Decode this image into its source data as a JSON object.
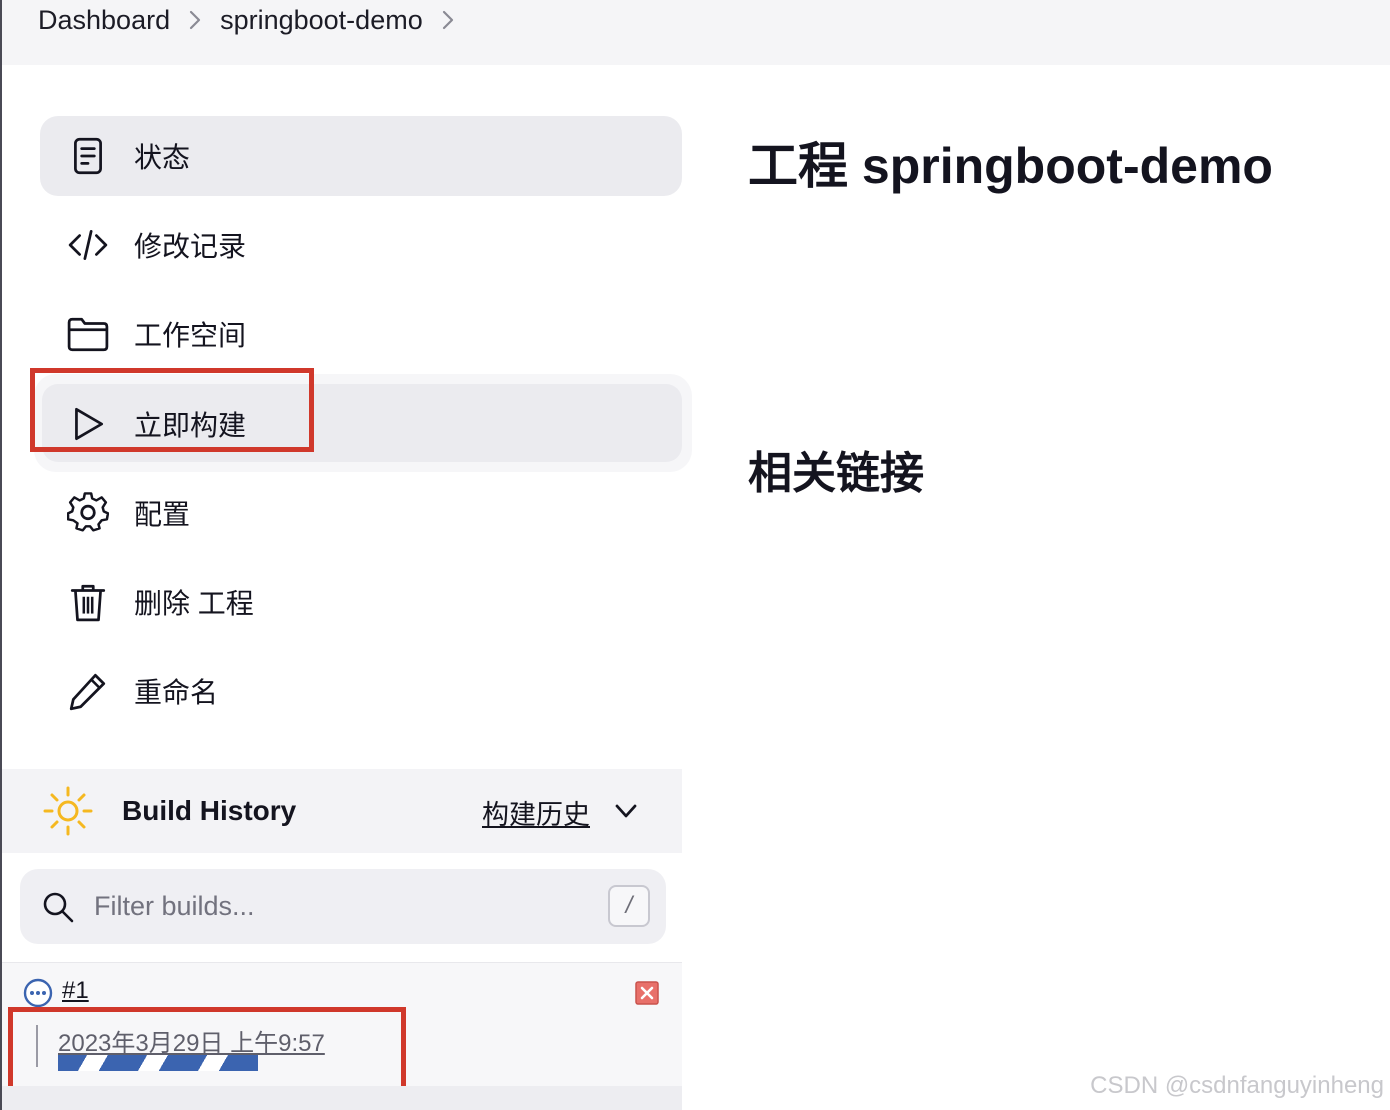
{
  "breadcrumb": {
    "items": [
      {
        "label": "Dashboard"
      },
      {
        "label": "springboot-demo"
      }
    ]
  },
  "sidebar": {
    "tasks": [
      {
        "label": "状态",
        "icon": "document-icon",
        "active": true
      },
      {
        "label": "修改记录",
        "icon": "code-icon"
      },
      {
        "label": "工作空间",
        "icon": "folder-icon"
      },
      {
        "label": "立即构建",
        "icon": "play-icon",
        "highlighted": true
      },
      {
        "label": "配置",
        "icon": "gear-icon"
      },
      {
        "label": "删除 工程",
        "icon": "trash-icon"
      },
      {
        "label": "重命名",
        "icon": "pencil-icon"
      }
    ]
  },
  "main": {
    "title": "工程 springboot-demo",
    "section_title": "相关链接"
  },
  "build_history": {
    "title": "Build History",
    "trend_link": "构建历史",
    "filter_placeholder": "Filter builds...",
    "filter_shortcut": "/",
    "builds": [
      {
        "number": "#1",
        "date": "2023年3月29日 上午9:57",
        "status": "in-progress",
        "progress_color": "#3b64b0"
      }
    ]
  },
  "watermark": "CSDN @csdnfanguyinheng",
  "colors": {
    "highlight_box": "#d0382b",
    "sun": "#f5b820",
    "active_bg": "#ebebef"
  }
}
